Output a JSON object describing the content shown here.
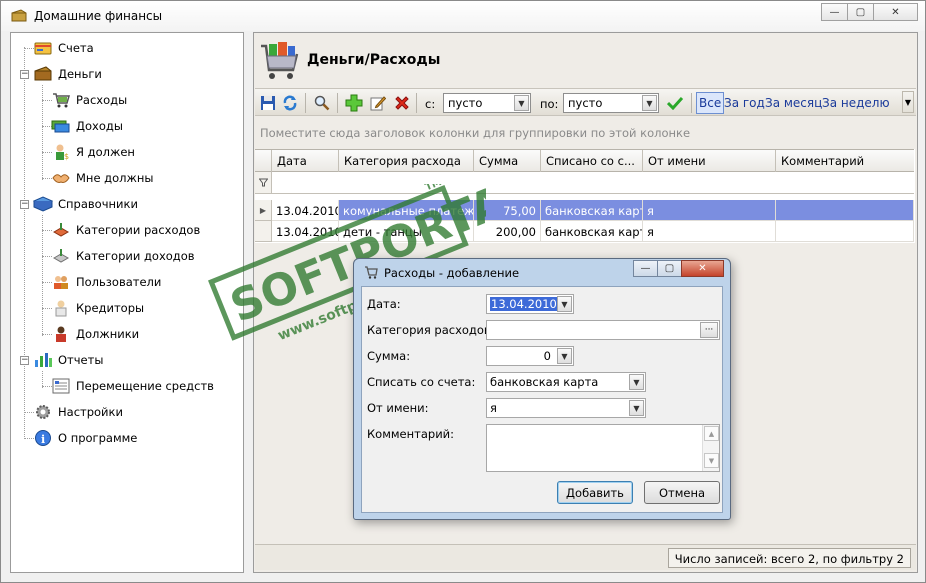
{
  "window": {
    "title": "Домашние финансы",
    "controls": {
      "minimize": "—",
      "maximize": "▢",
      "close": "✕"
    }
  },
  "tree": {
    "items": [
      {
        "label": "Счета",
        "icon": "card-icon"
      },
      {
        "label": "Деньги",
        "icon": "wallet-icon"
      },
      {
        "label": "Расходы",
        "icon": "cart-icon"
      },
      {
        "label": "Доходы",
        "icon": "money-icon"
      },
      {
        "label": "Я должен",
        "icon": "debtor-icon"
      },
      {
        "label": "Мне должны",
        "icon": "handshake-icon"
      },
      {
        "label": "Справочники",
        "icon": "books-icon"
      },
      {
        "label": "Категории расходов",
        "icon": "category-out-icon"
      },
      {
        "label": "Категории доходов",
        "icon": "category-in-icon"
      },
      {
        "label": "Пользователи",
        "icon": "users-icon"
      },
      {
        "label": "Кредиторы",
        "icon": "creditor-icon"
      },
      {
        "label": "Должники",
        "icon": "debtors-icon"
      },
      {
        "label": "Отчеты",
        "icon": "chart-icon"
      },
      {
        "label": "Перемещение средств",
        "icon": "report-icon"
      },
      {
        "label": "Настройки",
        "icon": "gear-icon"
      },
      {
        "label": "О программе",
        "icon": "info-icon"
      }
    ],
    "expand_minus": "−"
  },
  "main": {
    "title": "Деньги/Расходы",
    "toolbar": {
      "from_label": "с:",
      "from_value": "пусто",
      "to_label": "по:",
      "to_value": "пусто",
      "periods": [
        "Все",
        "За год",
        "За месяц",
        "За неделю"
      ]
    },
    "group_hint": "Поместите сюда заголовок колонки для группировки по этой колонке",
    "columns": [
      "Дата",
      "Категория расхода",
      "Сумма",
      "Списано со с...",
      "От имени",
      "Комментарий"
    ],
    "rows": [
      {
        "date": "13.04.2010",
        "category": "комунальные платежи",
        "sum": "75,00",
        "account": "банковская карта",
        "person": "я",
        "comment": ""
      },
      {
        "date": "13.04.2010",
        "category": "дети - танцы",
        "sum": "200,00",
        "account": "банковская карта",
        "person": "я",
        "comment": ""
      }
    ],
    "status": "Число записей: всего 2, по фильтру 2"
  },
  "dialog": {
    "title": "Расходы - добавление",
    "labels": {
      "date": "Дата:",
      "category": "Категория расходов:",
      "sum": "Сумма:",
      "account": "Списать со счета:",
      "person": "От имени:",
      "comment": "Комментарий:"
    },
    "values": {
      "date": "13.04.2010",
      "category": "",
      "sum": "0",
      "account": "банковская карта",
      "person": "я"
    },
    "buttons": {
      "add": "Добавить",
      "cancel": "Отмена"
    }
  },
  "watermark": {
    "brand": "SOFTPORTAL",
    "url": "www.softportal.com",
    "tm": "TM"
  },
  "colors": {
    "selection": "#7b8ee0",
    "dialog_frame": "#bed3ea",
    "watermark": "#2f7a2f"
  }
}
